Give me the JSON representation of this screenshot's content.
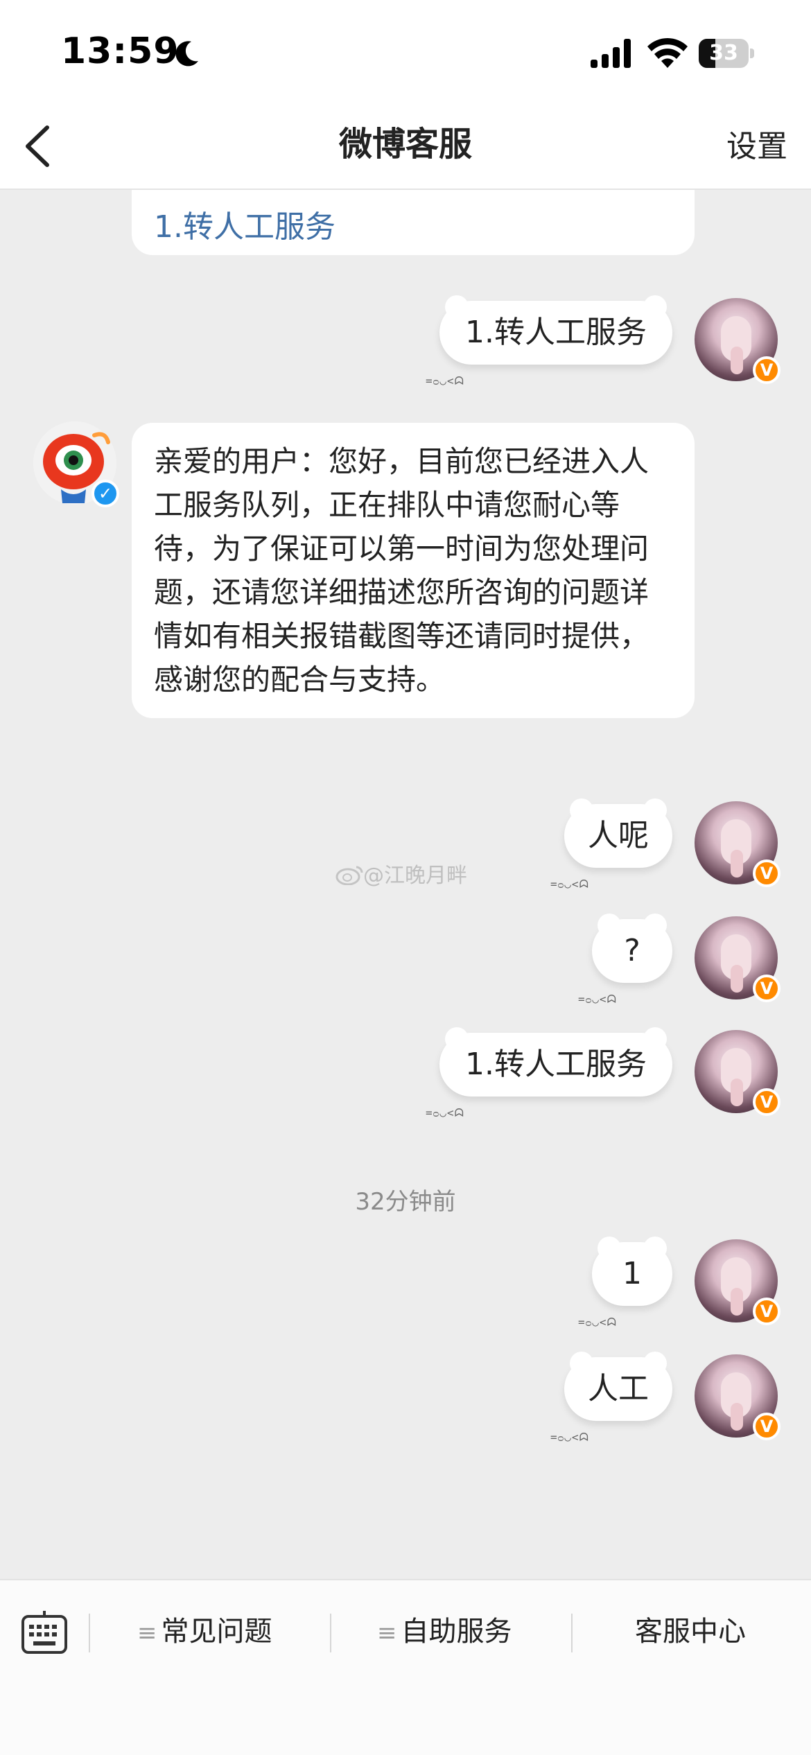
{
  "status_bar": {
    "time": "13:59",
    "battery": "33",
    "battery_level": 0.33,
    "icons": [
      "moon-icon",
      "signal-icon",
      "wifi-icon",
      "battery-icon"
    ]
  },
  "nav": {
    "title": "微博客服",
    "settings": "设置",
    "back_icon": "chevron-left-icon"
  },
  "chat": {
    "top_partial_text": "1.转人工服务",
    "messages": [
      {
        "side": "right",
        "text": "1.转人工服务"
      },
      {
        "side": "left",
        "text": "亲爱的用户：您好，目前您已经进入人工服务队列，正在排队中请您耐心等待，为了保证可以第一时间为您处理问题，还请您详细描述您所咨询的问题详情如有相关报错截图等还请同时提供，感谢您的配合与支持。"
      },
      {
        "side": "right",
        "text": "人呢"
      },
      {
        "side": "right",
        "text": "?"
      },
      {
        "side": "right",
        "text": "1.转人工服务"
      },
      {
        "side": "right",
        "text": "1"
      },
      {
        "side": "right",
        "text": "人工"
      }
    ],
    "bubble_decoration": "=ᴑ◡<ᗣ",
    "time_divider": "32分钟前",
    "watermark": "@江晚月畔"
  },
  "toolbar": {
    "items": [
      "常见问题",
      "自助服务",
      "客服中心"
    ],
    "menu_glyph": "≡"
  },
  "colors": {
    "link_blue": "#3f6fa6",
    "badge_orange": "#ff8a00",
    "badge_blue": "#1e97f0",
    "background": "#ededed"
  }
}
